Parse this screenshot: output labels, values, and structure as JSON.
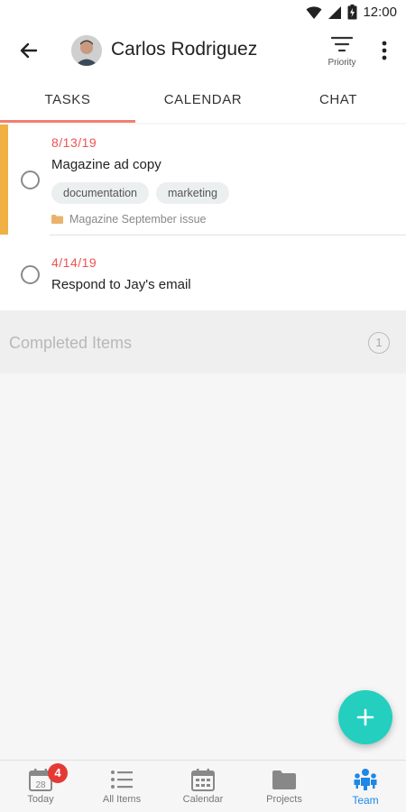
{
  "status_bar": {
    "time": "12:00"
  },
  "header": {
    "contact_name": "Carlos Rodriguez",
    "priority_label": "Priority"
  },
  "tabs": [
    {
      "label": "TASKS",
      "active": true
    },
    {
      "label": "CALENDAR",
      "active": false
    },
    {
      "label": "CHAT",
      "active": false
    }
  ],
  "tasks": [
    {
      "date": "8/13/19",
      "title": "Magazine ad copy",
      "tags": [
        "documentation",
        "marketing"
      ],
      "project": "Magazine September issue",
      "accent_color": "#f0b043"
    },
    {
      "date": "4/14/19",
      "title": "Respond to Jay's email"
    }
  ],
  "completed": {
    "label": "Completed Items",
    "count": "1"
  },
  "fab": {
    "icon": "plus-icon"
  },
  "bottom_nav": [
    {
      "label": "Today",
      "icon": "calendar-day-icon",
      "calendar_day": "28",
      "badge": "4"
    },
    {
      "label": "All Items",
      "icon": "list-icon"
    },
    {
      "label": "Calendar",
      "icon": "calendar-icon"
    },
    {
      "label": "Projects",
      "icon": "folder-icon"
    },
    {
      "label": "Team",
      "icon": "team-icon",
      "active": true
    }
  ],
  "colors": {
    "accent": "#24cfbf",
    "date": "#ef5350",
    "tab_indicator": "#f07f73",
    "active_nav": "#1e88e5"
  }
}
